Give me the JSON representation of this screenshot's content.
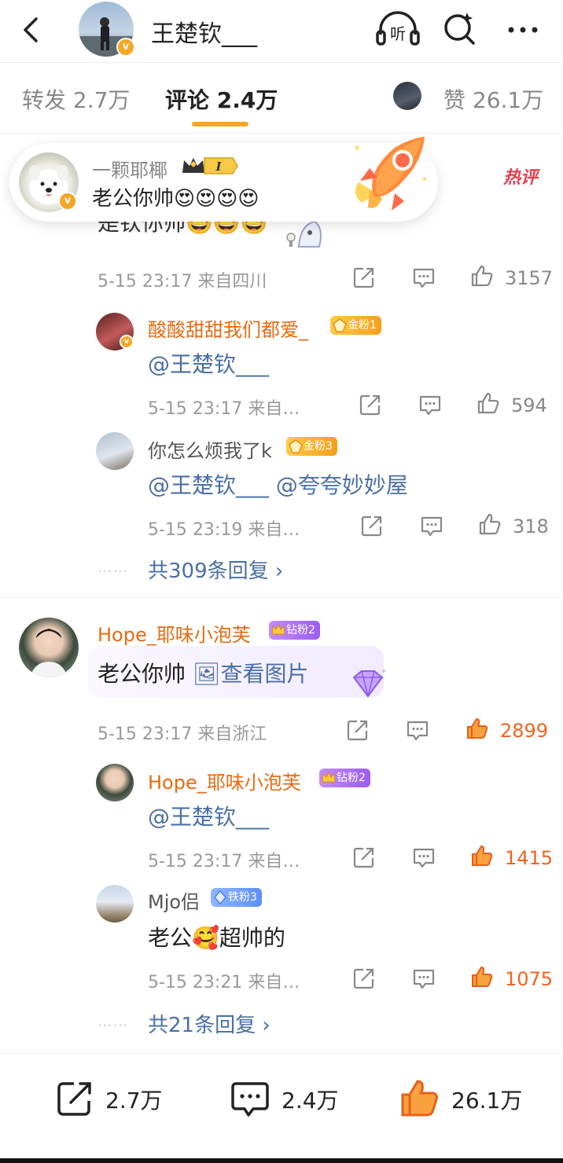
{
  "header": {
    "title": "王楚钦___",
    "listen_label": "听"
  },
  "tabs": [
    {
      "label": "转发 2.7万"
    },
    {
      "label": "评论 2.4万"
    },
    {
      "label": "赞 26.1万"
    }
  ],
  "hot_banner": {
    "username": "一颗耶椰",
    "level_badge": "I",
    "text": "老公你帅😍😍😍😍",
    "tag": "热评"
  },
  "comment1": {
    "partial_text": "是钦你帅🤩🤩🤩",
    "meta": "5-15 23:17 来自四川",
    "likes": "3157",
    "replies": [
      {
        "username": "酸酸甜甜我们都爱_",
        "badge": "金粉1",
        "text": "@王楚钦___",
        "meta": "5-15 23:17 来自…",
        "likes": "594"
      },
      {
        "username": "你怎么烦我了k",
        "badge": "金粉3",
        "text": "@王楚钦___ @夸夸妙妙屋",
        "meta": "5-15 23:19 来自…",
        "likes": "318"
      }
    ],
    "more_replies": "共309条回复 ›",
    "more_dots": "……"
  },
  "comment2": {
    "username": "Hope_耶味小泡芙",
    "badge": "钻粉2",
    "text": "老公你帅",
    "image_link": "🖼查看图片",
    "meta": "5-15 23:17 来自浙江",
    "likes": "2899",
    "replies": [
      {
        "username": "Hope_耶味小泡芙",
        "badge": "钻粉2",
        "text": "@王楚钦___",
        "meta": "5-15 23:17 来自…",
        "likes": "1415"
      },
      {
        "username": "Mjo侣",
        "badge": "铁粉3",
        "text": "老公🥰超帅的",
        "meta": "5-15 23:21 来自…",
        "likes": "1075"
      }
    ],
    "more_replies": "共21条回复 ›",
    "more_dots": "……"
  },
  "bottom_bar": {
    "repost": "2.7万",
    "comment": "2.4万",
    "like": "26.1万"
  },
  "colors": {
    "accent": "#f6a623",
    "like_active": "#f0641e",
    "mention": "#4a6fa5",
    "username_vip": "#e86a10",
    "hot_tag": "#e33f4f"
  },
  "icons": [
    "back-icon",
    "headphones-icon",
    "search-icon",
    "more-icon",
    "share-icon",
    "comment-icon",
    "like-icon",
    "rocket-icon"
  ]
}
